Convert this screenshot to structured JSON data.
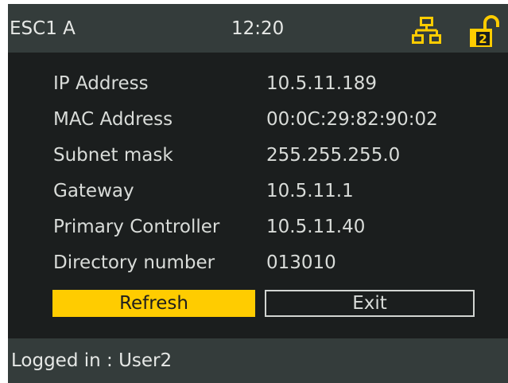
{
  "header": {
    "device_name": "ESC1 A",
    "time": "12:20",
    "network_icon": "network-icon",
    "lock_icon": "unlocked-padlock-icon",
    "lock_level": "2"
  },
  "info": {
    "rows": [
      {
        "label": "IP Address",
        "value": "10.5.11.189"
      },
      {
        "label": "MAC Address",
        "value": "00:0C:29:82:90:02"
      },
      {
        "label": "Subnet mask",
        "value": "255.255.255.0"
      },
      {
        "label": "Gateway",
        "value": "10.5.11.1"
      },
      {
        "label": "Primary Controller",
        "value": "10.5.11.40"
      },
      {
        "label": "Directory number",
        "value": "013010"
      }
    ]
  },
  "buttons": {
    "refresh_label": "Refresh",
    "exit_label": "Exit"
  },
  "footer": {
    "status": "Logged in : User2"
  },
  "colors": {
    "accent": "#ffcc00",
    "bar_background": "#343c3b",
    "screen_background": "#1b1e1e",
    "text": "#d9dcd9"
  }
}
